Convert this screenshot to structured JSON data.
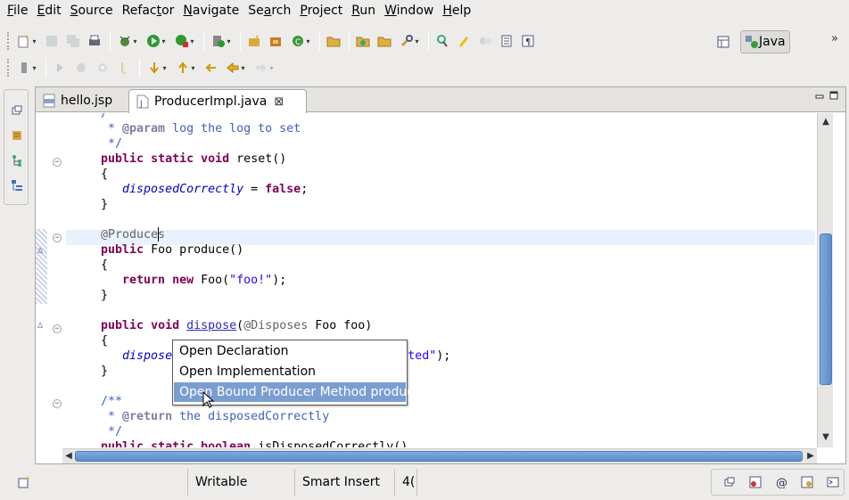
{
  "menubar": {
    "items": [
      {
        "label": "File",
        "mnemonic": "F"
      },
      {
        "label": "Edit",
        "mnemonic": "E"
      },
      {
        "label": "Source",
        "mnemonic": "S"
      },
      {
        "label": "Refactor",
        "mnemonic": "t"
      },
      {
        "label": "Navigate",
        "mnemonic": "N"
      },
      {
        "label": "Search",
        "mnemonic": "a"
      },
      {
        "label": "Project",
        "mnemonic": "P"
      },
      {
        "label": "Run",
        "mnemonic": "R"
      },
      {
        "label": "Window",
        "mnemonic": "W"
      },
      {
        "label": "Help",
        "mnemonic": "H"
      }
    ]
  },
  "perspective": {
    "active_label": "Java"
  },
  "editor": {
    "tabs": [
      {
        "label": "hello.jsp",
        "active": false
      },
      {
        "label": "ProducerImpl.java",
        "active": true
      }
    ],
    "close_glyph": "⊠"
  },
  "code": {
    "lines": [
      {
        "tokens": [
          {
            "t": "  /**",
            "c": "cm"
          }
        ]
      },
      {
        "tokens": [
          {
            "t": "   * ",
            "c": "cm"
          },
          {
            "t": "@param",
            "c": "tag"
          },
          {
            "t": " log the log to set",
            "c": "cm"
          }
        ]
      },
      {
        "tokens": [
          {
            "t": "   */",
            "c": "cm"
          }
        ]
      },
      {
        "tokens": [
          {
            "t": "  ",
            "c": ""
          },
          {
            "t": "public",
            "c": "kw"
          },
          {
            "t": " ",
            "c": ""
          },
          {
            "t": "static",
            "c": "kw"
          },
          {
            "t": " ",
            "c": ""
          },
          {
            "t": "void",
            "c": "kw"
          },
          {
            "t": " reset()",
            "c": ""
          }
        ]
      },
      {
        "tokens": [
          {
            "t": "  {",
            "c": ""
          }
        ]
      },
      {
        "tokens": [
          {
            "t": "     ",
            "c": ""
          },
          {
            "t": "disposedCorrectly",
            "c": "fld"
          },
          {
            "t": " = ",
            "c": ""
          },
          {
            "t": "false",
            "c": "kw"
          },
          {
            "t": ";",
            "c": ""
          }
        ]
      },
      {
        "tokens": [
          {
            "t": "  }",
            "c": ""
          }
        ]
      },
      {
        "tokens": [
          {
            "t": "",
            "c": ""
          }
        ]
      },
      {
        "tokens": [
          {
            "t": "  @Produces",
            "c": "ann"
          }
        ]
      },
      {
        "tokens": [
          {
            "t": "  ",
            "c": ""
          },
          {
            "t": "public",
            "c": "kw"
          },
          {
            "t": " Foo produce()",
            "c": ""
          }
        ]
      },
      {
        "tokens": [
          {
            "t": "  {",
            "c": ""
          }
        ]
      },
      {
        "tokens": [
          {
            "t": "     ",
            "c": ""
          },
          {
            "t": "return",
            "c": "kw"
          },
          {
            "t": " ",
            "c": ""
          },
          {
            "t": "new",
            "c": "kw"
          },
          {
            "t": " Foo(",
            "c": ""
          },
          {
            "t": "\"foo!\"",
            "c": "str"
          },
          {
            "t": ");",
            "c": ""
          }
        ]
      },
      {
        "tokens": [
          {
            "t": "  }",
            "c": ""
          }
        ]
      },
      {
        "tokens": [
          {
            "t": "",
            "c": ""
          }
        ]
      },
      {
        "tokens": [
          {
            "t": "  ",
            "c": ""
          },
          {
            "t": "public",
            "c": "kw"
          },
          {
            "t": " ",
            "c": ""
          },
          {
            "t": "void",
            "c": "kw"
          },
          {
            "t": " ",
            "c": ""
          },
          {
            "t": "dispose",
            "c": "lnk"
          },
          {
            "t": "(",
            "c": ""
          },
          {
            "t": "@Disposes",
            "c": "ann"
          },
          {
            "t": " Foo foo)",
            "c": ""
          }
        ]
      },
      {
        "tokens": [
          {
            "t": "  {",
            "c": ""
          }
        ]
      },
      {
        "tokens": [
          {
            "t": "     ",
            "c": ""
          },
          {
            "t": "disposedC",
            "c": "fld"
          },
          {
            "t": "                          ",
            "c": ""
          },
          {
            "t": "ecorated\"",
            "c": "str"
          },
          {
            "t": ");",
            "c": ""
          }
        ]
      },
      {
        "tokens": [
          {
            "t": "  }",
            "c": ""
          }
        ]
      },
      {
        "tokens": [
          {
            "t": "",
            "c": ""
          }
        ]
      },
      {
        "tokens": [
          {
            "t": "  /**",
            "c": "cm"
          }
        ]
      },
      {
        "tokens": [
          {
            "t": "   * ",
            "c": "cm"
          },
          {
            "t": "@return",
            "c": "tag"
          },
          {
            "t": " the disposedCorrectly",
            "c": "cm"
          }
        ]
      },
      {
        "tokens": [
          {
            "t": "   */",
            "c": "cm"
          }
        ]
      },
      {
        "tokens": [
          {
            "t": "  ",
            "c": ""
          },
          {
            "t": "public",
            "c": "kw"
          },
          {
            "t": " ",
            "c": ""
          },
          {
            "t": "static",
            "c": "kw"
          },
          {
            "t": " ",
            "c": ""
          },
          {
            "t": "boolean",
            "c": "kw"
          },
          {
            "t": " isDisposedCorrectly()",
            "c": ""
          }
        ]
      }
    ]
  },
  "popup": {
    "items": [
      {
        "label": "Open Declaration",
        "selected": false
      },
      {
        "label": "Open Implementation",
        "selected": false
      },
      {
        "label": "Open Bound Producer Method produce",
        "selected": true
      }
    ]
  },
  "status": {
    "writable": "Writable",
    "insert_mode": "Smart Insert",
    "position": "4("
  },
  "colors": {
    "keyword": "#7f0055",
    "comment": "#3f5fbf",
    "string": "#2a00ff",
    "field": "#0000c0",
    "selection": "#7b9ed1",
    "current_line": "#e8f2fe"
  }
}
